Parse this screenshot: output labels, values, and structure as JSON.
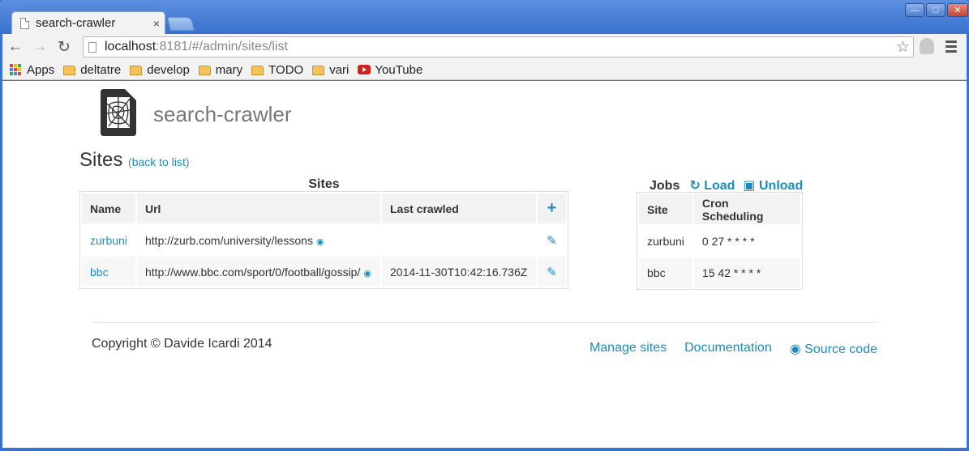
{
  "browser": {
    "tab_title": "search-crawler",
    "tab_close": "×",
    "url_host": "localhost",
    "url_rest": ":8181/#/admin/sites/list",
    "bookmarks": [
      {
        "label": "Apps",
        "icon": "apps-icon"
      },
      {
        "label": "deltatre",
        "icon": "folder-icon"
      },
      {
        "label": "develop",
        "icon": "folder-icon"
      },
      {
        "label": "mary",
        "icon": "folder-icon"
      },
      {
        "label": "TODO",
        "icon": "folder-icon"
      },
      {
        "label": "vari",
        "icon": "folder-icon"
      },
      {
        "label": "YouTube",
        "icon": "youtube-icon"
      }
    ]
  },
  "page": {
    "brand": "search-crawler",
    "heading": "Sites",
    "back_open": "(",
    "back_link": "back to list",
    "back_close": ")",
    "sites_table": {
      "caption": "Sites",
      "headers": [
        "Name",
        "Url",
        "Last crawled"
      ],
      "rows": [
        {
          "name": "zurbuni",
          "url": "http://zurb.com/university/lessons",
          "last_crawled": ""
        },
        {
          "name": "bbc",
          "url": "http://www.bbc.com/sport/0/football/gossip/",
          "last_crawled": "2014-11-30T10:42:16.736Z"
        }
      ]
    },
    "jobs": {
      "caption": "Jobs",
      "load": "Load",
      "unload": "Unload",
      "headers": [
        "Site",
        "Cron Scheduling"
      ],
      "rows": [
        {
          "site": "zurbuni",
          "cron": "0 27 * * * *"
        },
        {
          "site": "bbc",
          "cron": "15 42 * * * *"
        }
      ]
    },
    "footer": {
      "copyright": "Copyright © Davide Icardi 2014",
      "links": [
        "Manage sites",
        "Documentation",
        "Source code"
      ]
    }
  },
  "colors": {
    "link": "#1c8bbd",
    "frame": "#3a73cf"
  }
}
